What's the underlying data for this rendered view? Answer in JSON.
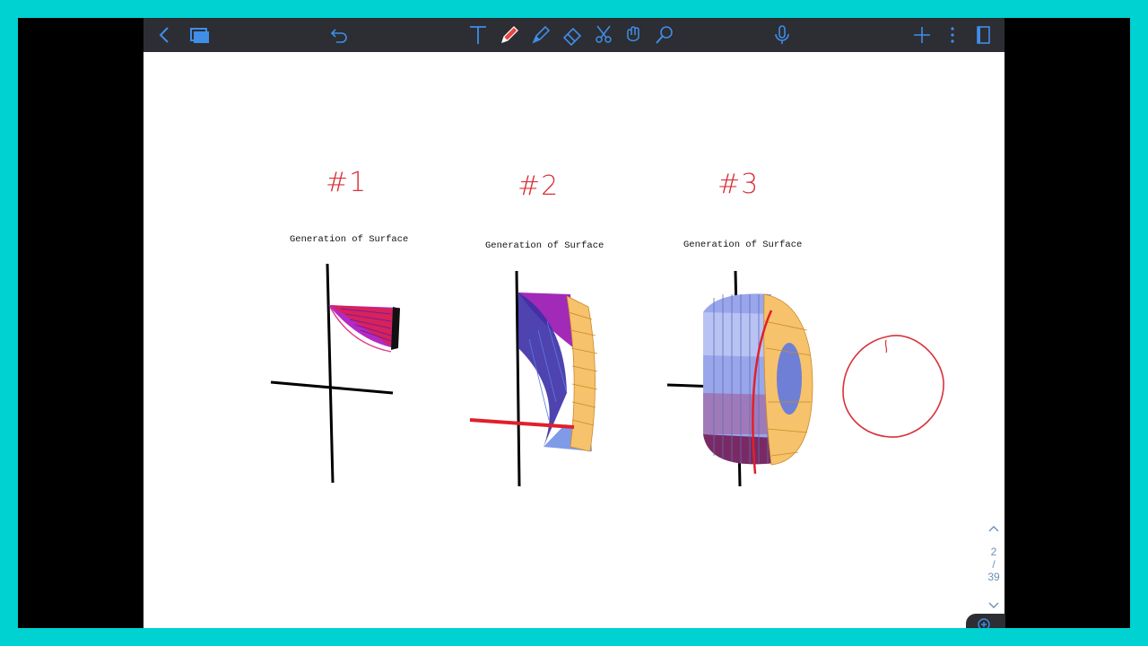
{
  "toolbar": {
    "icons": [
      "back-icon",
      "pages-icon",
      "undo-icon",
      "text-tool-icon",
      "pen-tool-icon",
      "highlighter-tool-icon",
      "eraser-tool-icon",
      "lasso-tool-icon",
      "shape-tool-icon",
      "laser-pointer-icon",
      "microphone-icon",
      "add-page-icon",
      "more-options-icon",
      "page-view-icon"
    ],
    "active_tool": "pen-tool-icon",
    "accent": "#e8453c"
  },
  "page": {
    "labels": [
      "#1",
      "#2",
      "#3"
    ],
    "captions": [
      "Generation of Surface",
      "Generation of Surface",
      "Generation of Surface"
    ],
    "ink_color": "#d8323a"
  },
  "pager": {
    "current": "2",
    "separator": "/",
    "total": "39"
  }
}
